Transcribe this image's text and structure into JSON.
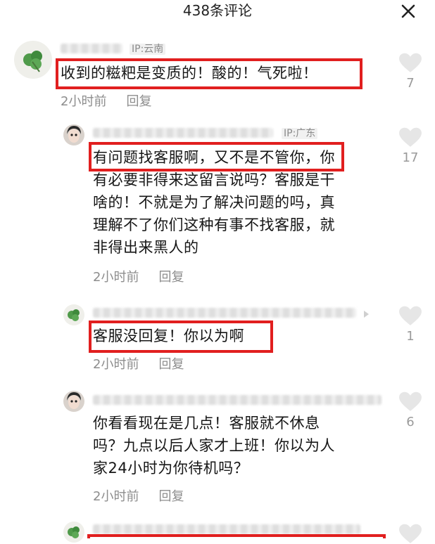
{
  "header": {
    "title": "438条评论"
  },
  "comments": [
    {
      "ip": "IP:云南",
      "text": "收到的糍粑是变质的！酸的！气死啦！",
      "time": "2小时前",
      "reply": "回复",
      "likes": "7"
    },
    {
      "ip": "IP:广东",
      "text_lines": [
        "有问题找客服啊，又不是不管你，你",
        "有必要非得来这留言说吗？客服是干",
        "啥的！不就是为了解决问题的吗，真",
        "理解不了你们这种有事不找客服，就",
        "非得出来黑人的"
      ],
      "time": "2小时前",
      "reply": "回复",
      "likes": "17"
    },
    {
      "text": "客服没回复！你以为啊",
      "time": "2小时前",
      "reply": "回复",
      "likes": "1"
    },
    {
      "text_lines": [
        "你看看现在是几点！客服就不休息",
        "吗？九点以后人家才上班！你以为人",
        "家24小时为你待机吗？"
      ],
      "time": "2小时前",
      "reply": "回复",
      "likes": "6"
    },
    {
      "likes": ""
    }
  ],
  "icons": {
    "close": "close-icon",
    "like": "heart-icon",
    "more": "chevron-right-icon"
  },
  "colors": {
    "highlight": "#e11f1f",
    "meta": "#8d8d8d",
    "heart": "#e6e6e6"
  }
}
